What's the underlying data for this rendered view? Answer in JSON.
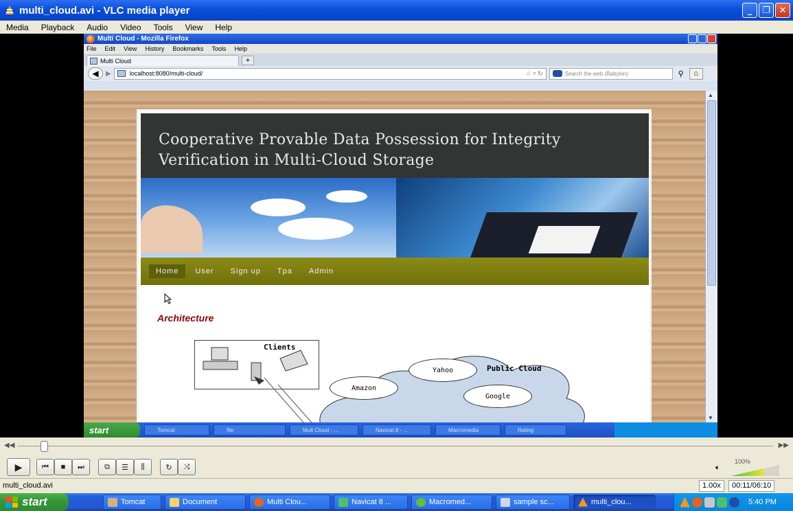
{
  "vlc": {
    "title": "multi_cloud.avi - VLC media player",
    "menu": [
      "Media",
      "Playback",
      "Audio",
      "Video",
      "Tools",
      "View",
      "Help"
    ],
    "status_file": "multi_cloud.avi",
    "rate": "1.00x",
    "time": "00:11/06:10",
    "volume": "100%",
    "seek_fraction": 0.03
  },
  "firefox": {
    "title": "Multi Cloud - Mozilla Firefox",
    "menu": [
      "File",
      "Edit",
      "View",
      "History",
      "Bookmarks",
      "Tools",
      "Help"
    ],
    "tab_label": "Multi Cloud",
    "new_tab": "+",
    "url": "localhost:8080/multi-cloud/",
    "search_placeholder": "Search the web (Babylon)"
  },
  "page": {
    "title": "Cooperative Provable Data Possession for Integrity Verification in Multi-Cloud Storage",
    "nav": [
      "Home",
      "User",
      "Sign up",
      "Tpa",
      "Admin"
    ],
    "section_heading": "Architecture",
    "diagram": {
      "clients": "Clients",
      "public_cloud": "Public Cloud",
      "nodes": [
        "Yahoo",
        "Amazon",
        "Google"
      ]
    }
  },
  "inner_taskbar": {
    "start": "start",
    "tasks": [
      "Tomcat",
      "file",
      "Mult Cloud - ...",
      "Navicat 8 - ...",
      "Macromedia",
      "Rating"
    ]
  },
  "taskbar": {
    "start": "start",
    "tasks": [
      "Tomcat",
      "Document",
      "Multi Clou...",
      "Navicat 8 ...",
      "Macromed...",
      "sample sc...",
      "multi_clou..."
    ],
    "clock": "5:40 PM"
  }
}
